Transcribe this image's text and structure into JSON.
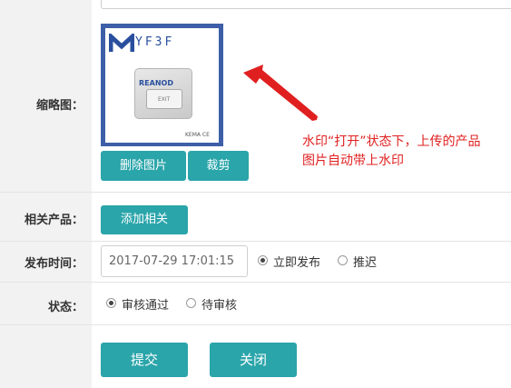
{
  "thumbnail": {
    "label": "缩略图：",
    "logo_text": "YF3F",
    "device_brand": "REANOD",
    "device_button_text": "EXIT",
    "cert_marks": "KEMA CE",
    "delete_button": "删除图片",
    "crop_button": "裁剪"
  },
  "related": {
    "label": "相关产品：",
    "add_button": "添加相关"
  },
  "publish": {
    "label": "发布时间：",
    "datetime_value": "2017-07-29 17:01:15",
    "option_now": "立即发布",
    "option_delay": "推迟",
    "selected": "now"
  },
  "status": {
    "label": "状态：",
    "option_approved": "审核通过",
    "option_pending": "待审核",
    "selected": "approved"
  },
  "actions": {
    "submit": "提交",
    "close": "关闭"
  },
  "annotation": {
    "line1": "水印“打开”状态下，上传的产品",
    "line2": "图片自动带上水印",
    "color": "#e02020"
  },
  "colors": {
    "accent": "#2aa5aa",
    "image_frame": "#3d5fa8"
  }
}
